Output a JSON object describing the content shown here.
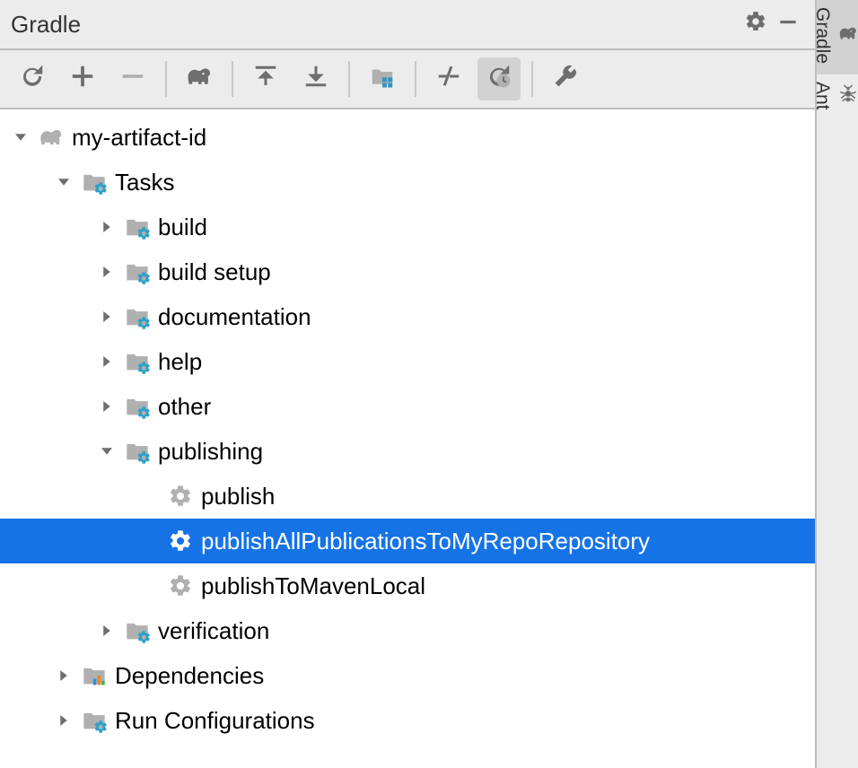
{
  "header": {
    "title": "Gradle"
  },
  "rail": {
    "tabs": [
      {
        "label": "Gradle",
        "active": true
      },
      {
        "label": "Ant",
        "active": false
      }
    ]
  },
  "toolbar": {
    "groups": [
      [
        {
          "name": "refresh-icon",
          "kind": "refresh"
        },
        {
          "name": "add-icon",
          "kind": "plus"
        },
        {
          "name": "remove-icon",
          "kind": "minus"
        }
      ],
      [
        {
          "name": "gradle-icon",
          "kind": "elephant"
        }
      ],
      [
        {
          "name": "expand-all-icon",
          "kind": "expand"
        },
        {
          "name": "collapse-all-icon",
          "kind": "collapse"
        }
      ],
      [
        {
          "name": "project-structure-icon",
          "kind": "folder-grid"
        }
      ],
      [
        {
          "name": "offline-mode-icon",
          "kind": "slash"
        },
        {
          "name": "execution-icon",
          "kind": "refresh-clock",
          "active": true
        }
      ],
      [
        {
          "name": "build-settings-icon",
          "kind": "wrench"
        }
      ]
    ]
  },
  "tree": {
    "nodes": [
      {
        "depth": 0,
        "expand": "open",
        "icon": "elephant",
        "label": "my-artifact-id",
        "selected": false
      },
      {
        "depth": 1,
        "expand": "open",
        "icon": "folder-gear",
        "label": "Tasks",
        "selected": false
      },
      {
        "depth": 2,
        "expand": "closed",
        "icon": "folder-gear",
        "label": "build",
        "selected": false
      },
      {
        "depth": 2,
        "expand": "closed",
        "icon": "folder-gear",
        "label": "build setup",
        "selected": false
      },
      {
        "depth": 2,
        "expand": "closed",
        "icon": "folder-gear",
        "label": "documentation",
        "selected": false
      },
      {
        "depth": 2,
        "expand": "closed",
        "icon": "folder-gear",
        "label": "help",
        "selected": false
      },
      {
        "depth": 2,
        "expand": "closed",
        "icon": "folder-gear",
        "label": "other",
        "selected": false
      },
      {
        "depth": 2,
        "expand": "open",
        "icon": "folder-gear",
        "label": "publishing",
        "selected": false
      },
      {
        "depth": 3,
        "expand": "none",
        "icon": "gear",
        "label": "publish",
        "selected": false
      },
      {
        "depth": 3,
        "expand": "none",
        "icon": "gear",
        "label": "publishAllPublicationsToMyRepoRepository",
        "selected": true
      },
      {
        "depth": 3,
        "expand": "none",
        "icon": "gear",
        "label": "publishToMavenLocal",
        "selected": false
      },
      {
        "depth": 2,
        "expand": "closed",
        "icon": "folder-gear",
        "label": "verification",
        "selected": false
      },
      {
        "depth": 1,
        "expand": "closed",
        "icon": "folder-chart",
        "label": "Dependencies",
        "selected": false
      },
      {
        "depth": 1,
        "expand": "closed",
        "icon": "folder-gear",
        "label": "Run Configurations",
        "selected": false
      }
    ]
  }
}
